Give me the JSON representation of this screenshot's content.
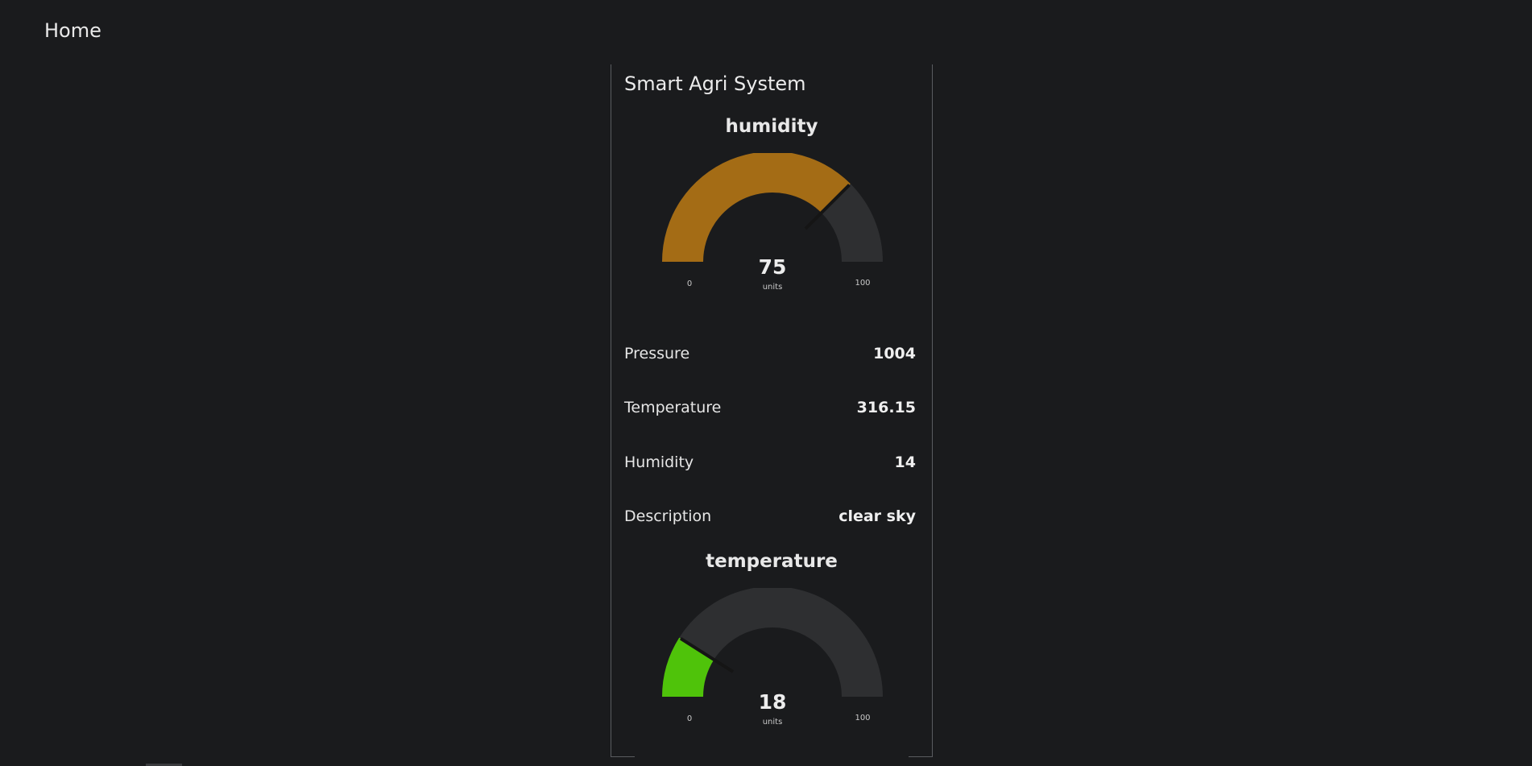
{
  "header": {
    "title": "Home"
  },
  "panel": {
    "title": "Smart Agri System",
    "gauges": [
      {
        "title": "humidity",
        "value": 75,
        "value_text": "75",
        "units": "units",
        "min": 0,
        "max": 100,
        "min_text": "0",
        "max_text": "100",
        "fill_color": "#a46c15",
        "track_color": "#2e2f31"
      },
      {
        "title": "temperature",
        "value": 18,
        "value_text": "18",
        "units": "units",
        "min": 0,
        "max": 100,
        "min_text": "0",
        "max_text": "100",
        "fill_color": "#4fc30a",
        "track_color": "#2e2f31"
      }
    ],
    "readings": [
      {
        "label": "Pressure",
        "value": "1004"
      },
      {
        "label": "Temperature",
        "value": "316.15"
      },
      {
        "label": "Humidity",
        "value": "14"
      },
      {
        "label": "Description",
        "value": "clear sky"
      }
    ]
  }
}
